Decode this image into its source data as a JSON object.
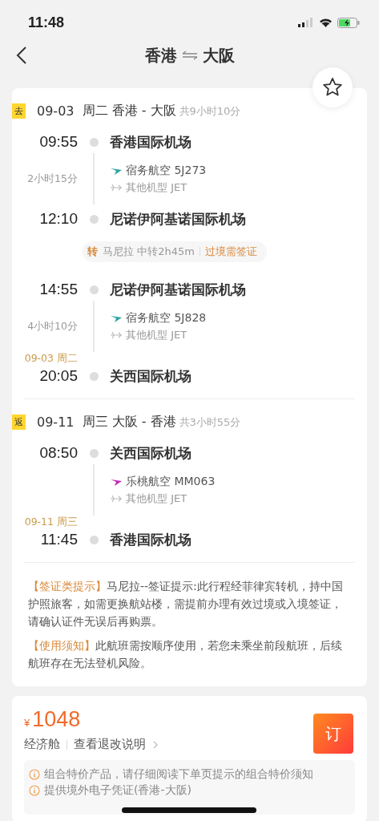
{
  "status_bar": {
    "time": "11:48"
  },
  "nav": {
    "from": "香港",
    "to": "大阪"
  },
  "trips": [
    {
      "badge": "去",
      "date": "09-03",
      "route": "周二 香港 - 大阪",
      "total": "共9小时10分",
      "items": [
        {
          "kind": "stop",
          "time": "09:55",
          "airport": "香港国际机场"
        },
        {
          "kind": "flight",
          "duration": "2小时15分",
          "airline": "宿务航空 5J273",
          "aircraft": "其他机型 JET",
          "color": "#2aa3a0"
        },
        {
          "kind": "stop",
          "time": "12:10",
          "airport": "尼诺伊阿基诺国际机场"
        },
        {
          "kind": "transfer",
          "badge": "转",
          "text": "马尼拉 中转2h45m",
          "visa": "过境需签证"
        },
        {
          "kind": "stop",
          "time": "14:55",
          "airport": "尼诺伊阿基诺国际机场"
        },
        {
          "kind": "flight",
          "duration": "4小时10分",
          "airline": "宿务航空 5J828",
          "aircraft": "其他机型 JET",
          "color": "#2aa3a0"
        },
        {
          "kind": "stop",
          "time": "20:05",
          "airport": "关西国际机场",
          "date_note": "09-03 周二"
        }
      ]
    },
    {
      "badge": "返",
      "date": "09-11",
      "route": "周三 大阪 - 香港",
      "total": "共3小时55分",
      "items": [
        {
          "kind": "stop",
          "time": "08:50",
          "airport": "关西国际机场"
        },
        {
          "kind": "flight",
          "airline": "乐桃航空 MM063",
          "aircraft": "其他机型 JET",
          "color": "#c02bb8"
        },
        {
          "kind": "stop",
          "time": "11:45",
          "airport": "香港国际机场",
          "date_note": "09-11 周三"
        }
      ]
    }
  ],
  "notices": [
    {
      "label": "【签证类提示】",
      "text": "马尼拉--签证提示:此行程经菲律宾转机，持中国护照旅客，如需更换航站楼，需提前办理有效过境或入境签证，请确认证件无误后再购票。"
    },
    {
      "label": "【使用须知】",
      "text": "此航班需按顺序使用，若您未乘坐前段航班，后续航班存在无法登机风险。"
    }
  ],
  "price": {
    "currency": "¥",
    "amount": "1048",
    "cabin": "经济舱",
    "rules_link": "查看退改说明",
    "book": "订"
  },
  "tips": [
    "组合特价产品，请仔细阅读下单页提示的组合特价须知",
    "提供境外电子凭证(香港-大阪)"
  ]
}
